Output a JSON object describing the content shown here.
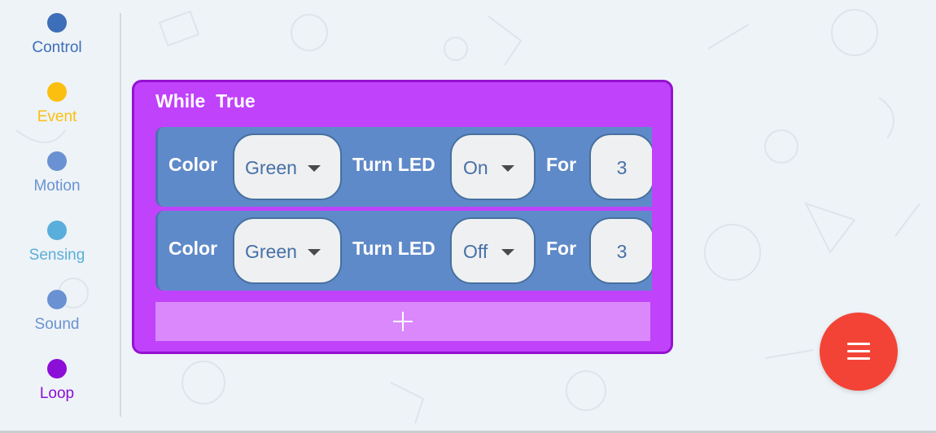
{
  "sidebar": {
    "items": [
      {
        "label": "Control",
        "color": "#3d6eb8",
        "label_color": "#3d6eb8"
      },
      {
        "label": "Event",
        "color": "#fbbf10",
        "label_color": "#fbbf10"
      },
      {
        "label": "Motion",
        "color": "#6a92d2",
        "label_color": "#6a92d2"
      },
      {
        "label": "Sensing",
        "color": "#5aaedb",
        "label_color": "#5aaedb"
      },
      {
        "label": "Sound",
        "color": "#6a92d2",
        "label_color": "#6a92d2"
      },
      {
        "label": "Loop",
        "color": "#8b0fd6",
        "label_color": "#8b0fd6"
      }
    ]
  },
  "loop_block": {
    "title": "While  True",
    "rows": [
      {
        "color_label": "Color",
        "color_value": "Green",
        "led_label": "Turn LED",
        "led_value": "On",
        "for_label": "For",
        "for_value": "3"
      },
      {
        "color_label": "Color",
        "color_value": "Green",
        "led_label": "Turn LED",
        "led_value": "Off",
        "for_label": "For",
        "for_value": "3"
      }
    ],
    "add_icon": "plus-icon"
  },
  "fab": {
    "icon": "menu-icon",
    "color": "#f34336"
  },
  "colors": {
    "loop": "#c042fb",
    "loop_border": "#9412d0",
    "block": "#5f8ac9",
    "add_bar": "#da88fc",
    "background": "#eef3f7"
  }
}
